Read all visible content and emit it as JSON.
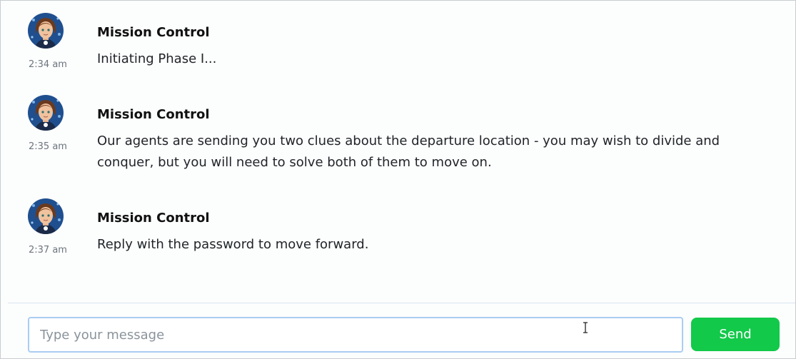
{
  "messages": [
    {
      "sender": "Mission Control",
      "time": "2:34 am",
      "text": "Initiating Phase I..."
    },
    {
      "sender": "Mission Control",
      "time": "2:35 am",
      "text": "Our agents are sending you two clues about the departure location - you may wish to divide and conquer, but you will need to solve both of them to move on."
    },
    {
      "sender": "Mission Control",
      "time": "2:37 am",
      "text": "Reply with the password to move forward."
    }
  ],
  "composer": {
    "placeholder": "Type your message",
    "value": "",
    "send_label": "Send"
  },
  "colors": {
    "send_button": "#12c94a",
    "input_focus_border": "#a9cdf3"
  },
  "icons": {
    "avatar": "avatar-mission-control",
    "cursor": "text-cursor-icon"
  }
}
